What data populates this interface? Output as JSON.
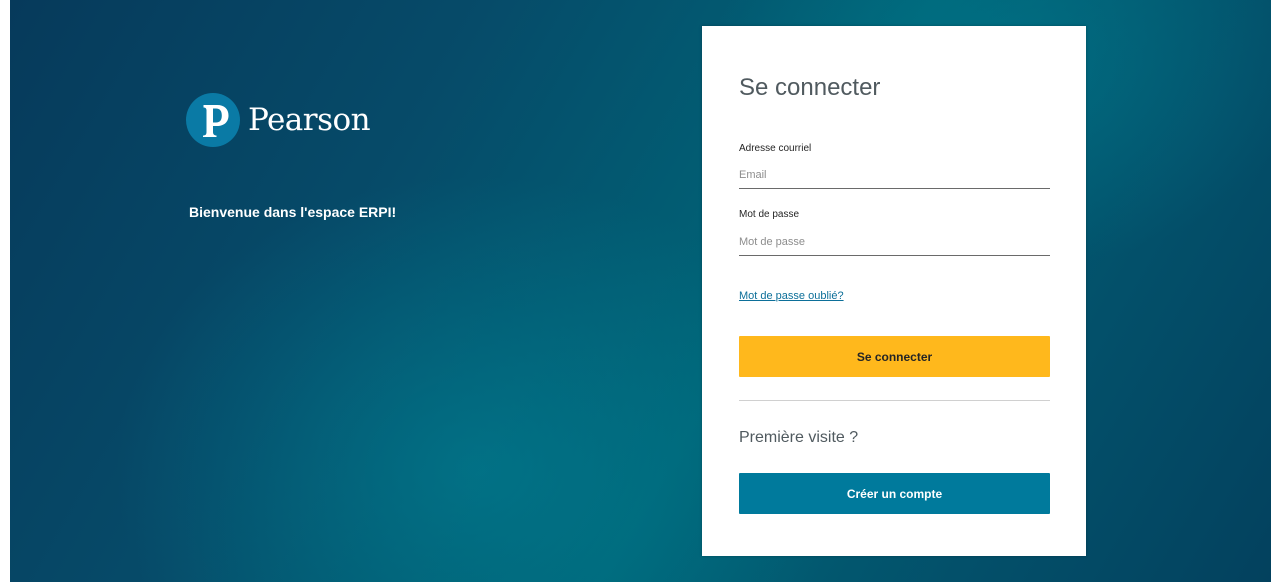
{
  "brand": {
    "logo_letter": "P",
    "name": "Pearson",
    "logo_color": "#0a7aa5"
  },
  "welcome_text": "Bienvenue dans l'espace ERPI!",
  "login": {
    "title": "Se connecter",
    "email_label": "Adresse courriel",
    "email_placeholder": "Email",
    "email_value": "",
    "password_label": "Mot de passe",
    "password_placeholder": "Mot de passe",
    "password_value": "",
    "forgot_link": "Mot de passe oublié?",
    "signin_button": "Se connecter",
    "first_visit": "Première visite ?",
    "create_button": "Créer un compte"
  },
  "colors": {
    "signin_button": "#ffb81c",
    "create_button": "#007a9c",
    "link": "#0c6f99",
    "background": "#064b69"
  }
}
